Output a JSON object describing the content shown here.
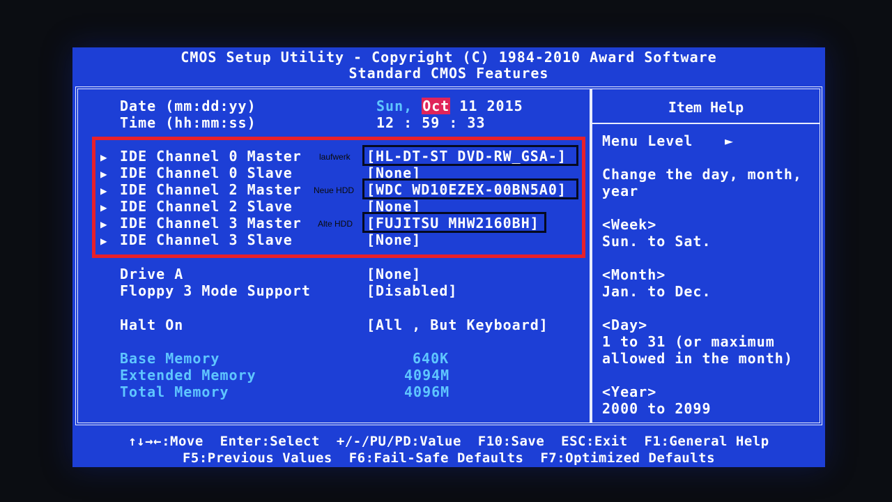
{
  "header": {
    "title": "CMOS Setup Utility - Copyright (C) 1984-2010 Award Software",
    "subtitle": "Standard CMOS Features"
  },
  "date": {
    "label": "Date (mm:dd:yy)",
    "weekday": "Sun,",
    "month": "Oct",
    "day_year": "11 2015"
  },
  "time": {
    "label": "Time (hh:mm:ss)",
    "value": "12 : 59 : 33"
  },
  "ide": [
    {
      "label": "IDE Channel 0 Master",
      "value": "[HL-DT-ST DVD-RW_GSA-]",
      "annotation": "laufwerk"
    },
    {
      "label": "IDE Channel 0 Slave",
      "value": "[None]"
    },
    {
      "label": "IDE Channel 2 Master",
      "value": "[WDC WD10EZEX-00BN5A0]",
      "annotation": "Neue HDD"
    },
    {
      "label": "IDE Channel 2 Slave",
      "value": "[None]"
    },
    {
      "label": "IDE Channel 3 Master",
      "value": "[FUJITSU MHW2160BH]",
      "annotation": "Alte HDD"
    },
    {
      "label": "IDE Channel 3 Slave",
      "value": "[None]"
    }
  ],
  "drive_a": {
    "label": "Drive A",
    "value": "[None]"
  },
  "floppy": {
    "label": "Floppy 3 Mode Support",
    "value": "[Disabled]"
  },
  "halt": {
    "label": "Halt On",
    "value": "[All , But Keyboard]"
  },
  "memory": [
    {
      "label": "Base Memory",
      "value": "640K"
    },
    {
      "label": "Extended Memory",
      "value": "4094M"
    },
    {
      "label": "Total Memory",
      "value": "4096M"
    }
  ],
  "help": {
    "title": "Item Help",
    "menu_level": "Menu Level",
    "menu_level_arrow": "►",
    "desc1": "Change the day, month,",
    "desc2": "year",
    "week_h": "<Week>",
    "week_v": "Sun. to Sat.",
    "month_h": "<Month>",
    "month_v": "Jan. to Dec.",
    "day_h": "<Day>",
    "day_v1": "1 to 31 (or maximum",
    "day_v2": "allowed in the month)",
    "year_h": "<Year>",
    "year_v": "2000 to 2099"
  },
  "footer": {
    "line1": "↑↓→←:Move  Enter:Select  +/-/PU/PD:Value  F10:Save  ESC:Exit  F1:General Help",
    "line2": "F5:Previous Values  F6:Fail-Safe Defaults  F7:Optimized Defaults"
  },
  "colors": {
    "background": "#1d3fd6",
    "text": "#ffffff",
    "dim_text": "#5fc6ff",
    "selected": "#e0245a",
    "annotation_box": "#e8202a"
  }
}
